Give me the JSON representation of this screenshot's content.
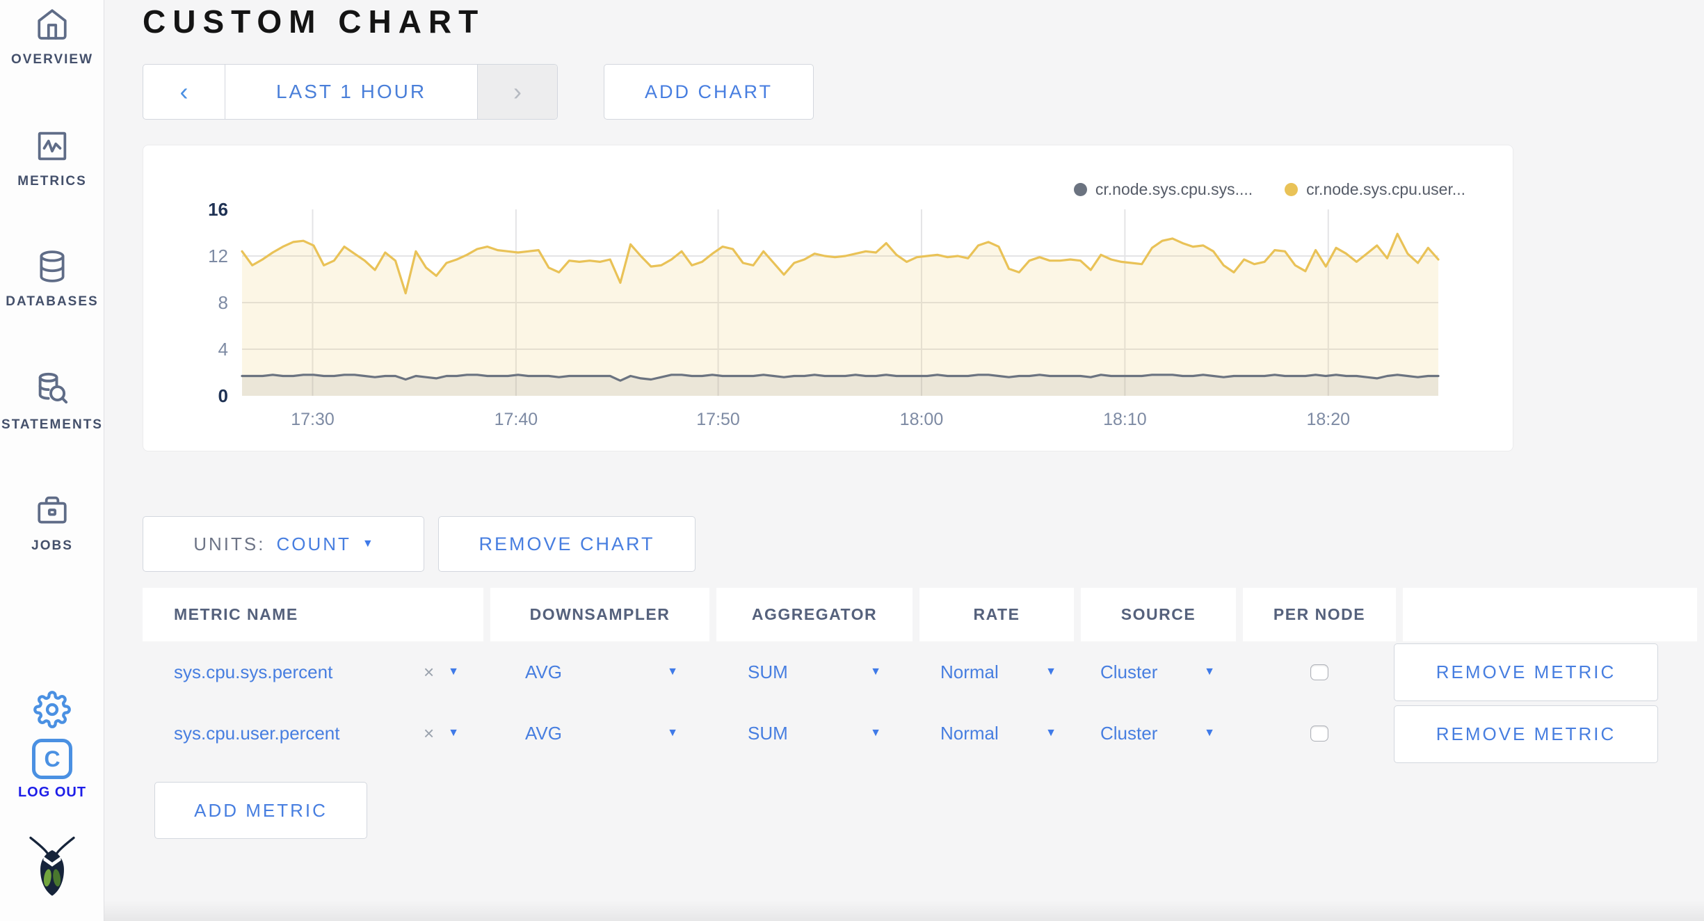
{
  "sidebar": {
    "items": [
      {
        "label": "OVERVIEW"
      },
      {
        "label": "METRICS"
      },
      {
        "label": "DATABASES"
      },
      {
        "label": "STATEMENTS"
      },
      {
        "label": "JOBS"
      }
    ],
    "logout_label": "LOG OUT",
    "logo_monogram": "C"
  },
  "header": {
    "title": "CUSTOM CHART"
  },
  "time_selector": {
    "label": "LAST 1 HOUR"
  },
  "add_chart_label": "ADD CHART",
  "glyphs": {
    "prev": "‹",
    "next": "›",
    "caret": "▼",
    "clear": "×"
  },
  "units": {
    "label": "UNITS:",
    "value": "COUNT"
  },
  "remove_chart_label": "REMOVE CHART",
  "chart_data": {
    "type": "line",
    "ylim": [
      0,
      16
    ],
    "y_ticks": [
      0,
      4,
      8,
      12,
      16
    ],
    "x_ticks": [
      {
        "pos": 0.059,
        "label": "17:30"
      },
      {
        "pos": 0.229,
        "label": "17:40"
      },
      {
        "pos": 0.398,
        "label": "17:50"
      },
      {
        "pos": 0.568,
        "label": "18:00"
      },
      {
        "pos": 0.738,
        "label": "18:10"
      },
      {
        "pos": 0.908,
        "label": "18:20"
      }
    ],
    "legend_position": "top-right",
    "grid": true,
    "series": [
      {
        "name": "cr.node.sys.cpu.sys....",
        "color": "#6b7380",
        "fill": "rgba(120,124,130,0.13)",
        "values": [
          1.7,
          1.7,
          1.7,
          1.8,
          1.7,
          1.7,
          1.8,
          1.8,
          1.7,
          1.7,
          1.8,
          1.8,
          1.7,
          1.6,
          1.7,
          1.7,
          1.4,
          1.7,
          1.6,
          1.5,
          1.7,
          1.7,
          1.8,
          1.8,
          1.7,
          1.7,
          1.7,
          1.8,
          1.7,
          1.7,
          1.7,
          1.6,
          1.7,
          1.7,
          1.7,
          1.7,
          1.7,
          1.3,
          1.7,
          1.5,
          1.4,
          1.6,
          1.8,
          1.8,
          1.7,
          1.7,
          1.8,
          1.7,
          1.7,
          1.7,
          1.7,
          1.8,
          1.7,
          1.6,
          1.7,
          1.7,
          1.8,
          1.7,
          1.7,
          1.7,
          1.8,
          1.7,
          1.7,
          1.8,
          1.7,
          1.7,
          1.7,
          1.7,
          1.8,
          1.7,
          1.7,
          1.7,
          1.8,
          1.8,
          1.7,
          1.6,
          1.7,
          1.7,
          1.8,
          1.7,
          1.7,
          1.7,
          1.7,
          1.6,
          1.8,
          1.7,
          1.7,
          1.7,
          1.7,
          1.8,
          1.8,
          1.8,
          1.7,
          1.7,
          1.8,
          1.7,
          1.6,
          1.7,
          1.7,
          1.7,
          1.7,
          1.8,
          1.7,
          1.7,
          1.7,
          1.8,
          1.7,
          1.8,
          1.7,
          1.7,
          1.6,
          1.5,
          1.7,
          1.8,
          1.7,
          1.6,
          1.7,
          1.7
        ]
      },
      {
        "name": "cr.node.sys.cpu.user...",
        "color": "#e9c257",
        "fill": "rgba(236,201,94,0.16)",
        "values": [
          12.4,
          11.2,
          11.7,
          12.3,
          12.8,
          13.2,
          13.3,
          12.9,
          11.2,
          11.6,
          12.8,
          12.2,
          11.6,
          10.8,
          12.3,
          11.6,
          8.8,
          12.4,
          11.0,
          10.3,
          11.4,
          11.7,
          12.1,
          12.6,
          12.8,
          12.5,
          12.4,
          12.3,
          12.4,
          12.5,
          11.0,
          10.6,
          11.6,
          11.5,
          11.6,
          11.5,
          11.7,
          9.7,
          13.0,
          12.0,
          11.1,
          11.2,
          11.7,
          12.4,
          11.2,
          11.5,
          12.2,
          12.8,
          12.6,
          11.4,
          11.2,
          12.4,
          11.4,
          10.4,
          11.4,
          11.7,
          12.2,
          12.0,
          11.9,
          12.0,
          12.2,
          12.4,
          12.3,
          13.1,
          12.1,
          11.5,
          11.9,
          12.0,
          12.1,
          11.9,
          12.0,
          11.8,
          12.9,
          13.2,
          12.8,
          10.9,
          10.6,
          11.6,
          11.9,
          11.6,
          11.6,
          11.7,
          11.6,
          10.8,
          12.1,
          11.7,
          11.5,
          11.4,
          11.3,
          12.7,
          13.3,
          13.5,
          13.1,
          12.8,
          12.9,
          12.4,
          11.2,
          10.6,
          11.7,
          11.3,
          11.5,
          12.5,
          12.4,
          11.2,
          10.7,
          12.5,
          11.1,
          12.7,
          12.2,
          11.5,
          12.2,
          12.9,
          11.8,
          13.9,
          12.2,
          11.4,
          12.7,
          11.7
        ]
      }
    ]
  },
  "metrics_table": {
    "headers": [
      "METRIC NAME",
      "DOWNSAMPLER",
      "AGGREGATOR",
      "RATE",
      "SOURCE",
      "PER NODE",
      ""
    ],
    "rows": [
      {
        "name": "sys.cpu.sys.percent",
        "downsampler": "AVG",
        "aggregator": "SUM",
        "rate": "Normal",
        "source": "Cluster",
        "per_node_checked": false
      },
      {
        "name": "sys.cpu.user.percent",
        "downsampler": "AVG",
        "aggregator": "SUM",
        "rate": "Normal",
        "source": "Cluster",
        "per_node_checked": false
      }
    ],
    "remove_metric_label": "REMOVE METRIC",
    "add_metric_label": "ADD METRIC"
  }
}
